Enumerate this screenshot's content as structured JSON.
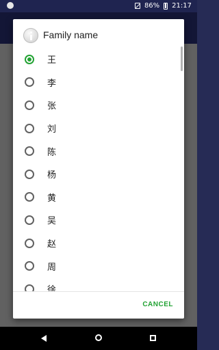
{
  "status_bar": {
    "battery": "86%",
    "time": "21:17"
  },
  "dialog": {
    "title": "Family name",
    "options": [
      "王",
      "李",
      "张",
      "刘",
      "陈",
      "杨",
      "黄",
      "吴",
      "赵",
      "周",
      "徐"
    ],
    "selected_index": 0,
    "cancel_label": "CANCEL"
  },
  "colors": {
    "accent": "#22a233",
    "toolbar": "#2f3680",
    "status_bar": "#1f2450"
  },
  "icons": {
    "header": "info-icon",
    "nav": [
      "back-icon",
      "home-icon",
      "recents-icon"
    ]
  }
}
